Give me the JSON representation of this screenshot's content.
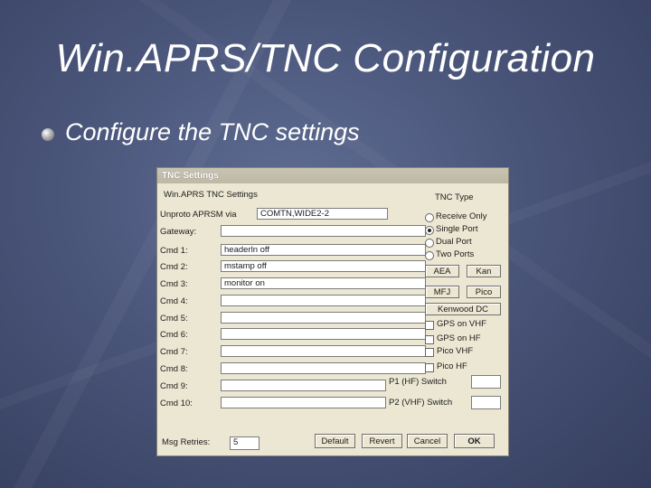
{
  "slide": {
    "title": "Win.APRS/TNC Configuration",
    "bullet": "Configure the TNC settings"
  },
  "dialog": {
    "titlebar": "TNC Settings",
    "heading": "Win.APRS TNC Settings",
    "unproto_label": "Unproto APRSM via",
    "unproto_value": "COMTN,WIDE2-2",
    "gateway_label": "Gateway:",
    "gateway_value": "",
    "cmds": [
      {
        "label": "Cmd 1:",
        "value": "headerln off"
      },
      {
        "label": "Cmd 2:",
        "value": "mstamp off"
      },
      {
        "label": "Cmd 3:",
        "value": "monitor on"
      },
      {
        "label": "Cmd 4:",
        "value": ""
      },
      {
        "label": "Cmd 5:",
        "value": ""
      },
      {
        "label": "Cmd 6:",
        "value": ""
      },
      {
        "label": "Cmd 7:",
        "value": ""
      },
      {
        "label": "Cmd 8:",
        "value": ""
      },
      {
        "label": "Cmd 9:",
        "value": ""
      },
      {
        "label": "Cmd 10:",
        "value": ""
      }
    ],
    "tnc_type": {
      "label": "TNC Type",
      "options": [
        {
          "label": "Receive Only",
          "selected": false
        },
        {
          "label": "Single Port",
          "selected": true
        },
        {
          "label": "Dual Port",
          "selected": false
        },
        {
          "label": "Two Ports",
          "selected": false
        }
      ]
    },
    "preset_buttons": {
      "aea": "AEA",
      "kan": "Kan",
      "mfj": "MFJ",
      "pico": "Pico",
      "kenwood": "Kenwood DC"
    },
    "checkboxes": [
      {
        "label": "GPS on VHF",
        "checked": false
      },
      {
        "label": "GPS on HF",
        "checked": false
      },
      {
        "label": "Pico VHF",
        "checked": false
      },
      {
        "label": "Pico HF",
        "checked": false
      }
    ],
    "p1_label": "P1 (HF) Switch",
    "p1_value": "",
    "p2_label": "P2 (VHF) Switch",
    "p2_value": "",
    "retries_label": "Msg Retries:",
    "retries_value": "5",
    "footer_buttons": {
      "default": "Default",
      "revert": "Revert",
      "cancel": "Cancel",
      "ok": "OK"
    }
  }
}
